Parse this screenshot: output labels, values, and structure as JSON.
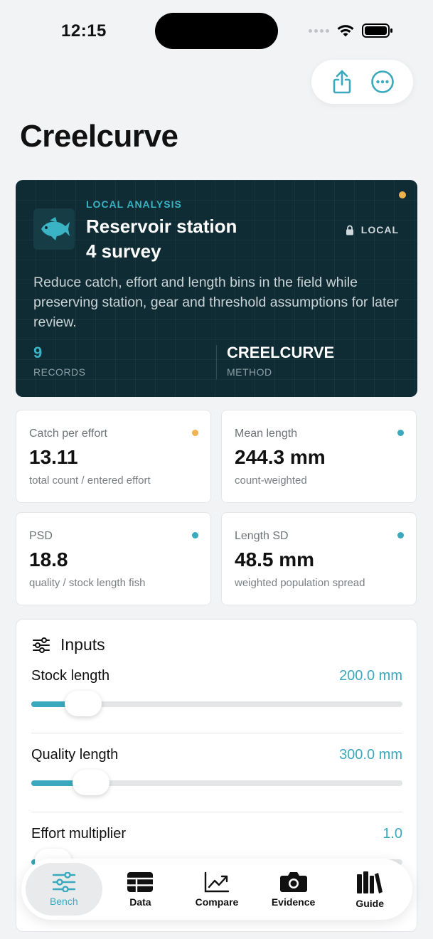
{
  "status_bar": {
    "time": "12:15"
  },
  "app": {
    "title": "Creelcurve"
  },
  "hero": {
    "eyebrow": "LOCAL ANALYSIS",
    "title_line1": "Reservoir station",
    "title_line2": "4 survey",
    "badge": "LOCAL",
    "description": "Reduce catch, effort and length bins in the field while preserving station, gear and threshold assumptions for later review.",
    "records_value": "9",
    "records_label": "RECORDS",
    "method_value": "CREELCURVE",
    "method_label": "METHOD",
    "status_dot_color": "#f0b24e",
    "icon": "fish-icon"
  },
  "metrics": [
    {
      "label": "Catch per effort",
      "value": "13.11",
      "sub": "total count / entered effort",
      "dot_color": "#f0b24e"
    },
    {
      "label": "Mean length",
      "value": "244.3 mm",
      "sub": "count-weighted",
      "dot_color": "#3aa9bd"
    },
    {
      "label": "PSD",
      "value": "18.8",
      "sub": "quality / stock length fish",
      "dot_color": "#3aa9bd"
    },
    {
      "label": "Length SD",
      "value": "48.5 mm",
      "sub": "weighted population spread",
      "dot_color": "#3aa9bd"
    }
  ],
  "inputs": {
    "title": "Inputs",
    "sliders": [
      {
        "label": "Stock length",
        "value": "200.0 mm",
        "fraction": 0.14
      },
      {
        "label": "Quality length",
        "value": "300.0 mm",
        "fraction": 0.16
      },
      {
        "label": "Effort multiplier",
        "value": "1.0",
        "fraction": 0.06
      }
    ]
  },
  "tabs": [
    {
      "label": "Bench",
      "icon": "sliders-icon",
      "active": true
    },
    {
      "label": "Data",
      "icon": "table-icon",
      "active": false
    },
    {
      "label": "Compare",
      "icon": "trend-chart-icon",
      "active": false
    },
    {
      "label": "Evidence",
      "icon": "camera-icon",
      "active": false
    },
    {
      "label": "Guide",
      "icon": "books-icon",
      "active": false
    }
  ],
  "colors": {
    "accent": "#3aa9bd",
    "warning": "#f0b24e",
    "hero_bg": "#0f2b33"
  }
}
